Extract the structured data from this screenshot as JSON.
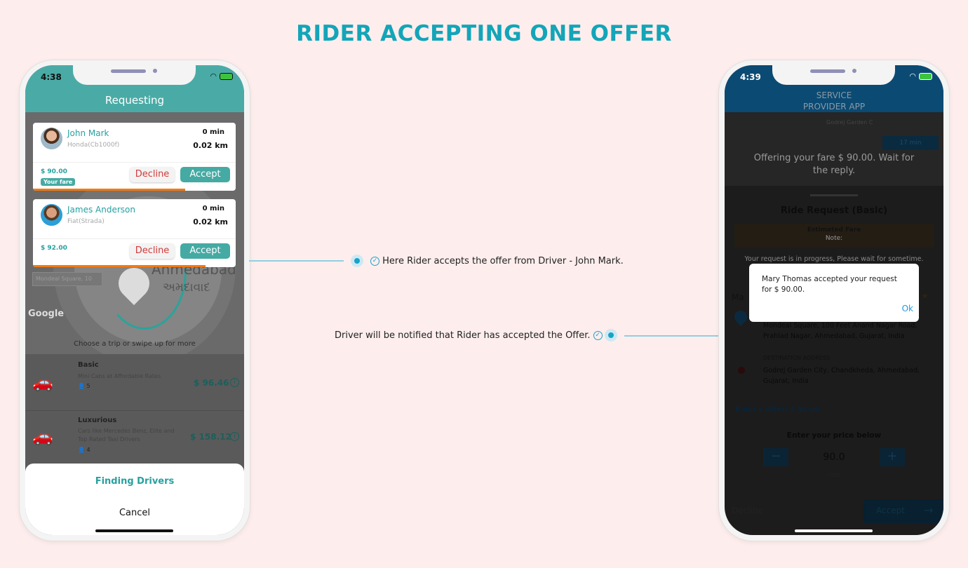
{
  "page_title": "RIDER ACCEPTING ONE OFFER",
  "annotations": {
    "rider_note": "Here Rider accepts the offer from Driver - John Mark.",
    "driver_note": "Driver will be notified that Rider has accepted the Offer."
  },
  "rider_app": {
    "status_time": "4:38",
    "header_title": "Requesting",
    "offers": [
      {
        "name": "John Mark",
        "vehicle": "Honda(Cb1000f)",
        "eta": "0 min",
        "distance": "0.02 km",
        "fare": "$ 90.00",
        "badge": "Your fare",
        "decline": "Decline",
        "accept": "Accept",
        "timer_progress": 0.75
      },
      {
        "name": "James Anderson",
        "vehicle": "Fiat(Strada)",
        "eta": "0 min",
        "distance": "0.02 km",
        "fare": "$ 92.00",
        "decline": "Decline",
        "accept": "Accept",
        "timer_progress": 0.85
      }
    ],
    "map": {
      "city": "Ahmedabad",
      "city_local": "અમદાવાદ",
      "search": "Mondeal Square, 10",
      "logo": "Google"
    },
    "choose_hint": "Choose a trip or swipe up for more",
    "trips": [
      {
        "name": "Basic",
        "desc": "Mini Cabs at Affordable Rates",
        "seats": "5",
        "price": "$ 96.46"
      },
      {
        "name": "Luxurious",
        "desc": "Cars like Mercedes Benz, Elite and Top Rated Taxi Drivers",
        "seats": "4",
        "price": "$ 158.12"
      }
    ],
    "finding": "Finding  Drivers",
    "cancel": "Cancel"
  },
  "driver_app": {
    "status_time": "4:39",
    "header_title_1": "SERVICE",
    "header_title_2": "PROVIDER APP",
    "map_eta": "17 min",
    "map_place": "Godrej Garden C",
    "offering_msg": "Offering your fare $ 90.00. Wait for the reply.",
    "ride_request_title": "Ride Request (Basic)",
    "estimated_fare": "Estimated Fare",
    "note": "Note:",
    "progress_msg": "Your request is in progress, Please wait for sometime.",
    "rider_name_partial": "Ma",
    "pickup": "Mondeal Square, 100 Feet Anand Nagar Road, Prahlad Nagar, Ahmedabad, Gujarat, India",
    "destination_label": "DESTINATION ADDRESS",
    "destination": "Godrej Garden City, Chandkheda, Ahmedabad, Gujarat, India",
    "riders_offer": "Rider's Offer: $ 90.00",
    "enter_price": "Enter your price below",
    "price_value": "90.0",
    "currency": "USD",
    "decline": "Decline",
    "accept": "Accept",
    "dialog": {
      "message": "Mary Thomas accepted your request for $ 90.00.",
      "ok": "Ok"
    }
  },
  "colors": {
    "title": "#13a5b8",
    "rider_header": "#4aaba6",
    "driver_header": "#0b4a73",
    "accent_orange": "#f47a10",
    "decline_red": "#d33a3a",
    "ok_blue": "#1a9be6"
  }
}
